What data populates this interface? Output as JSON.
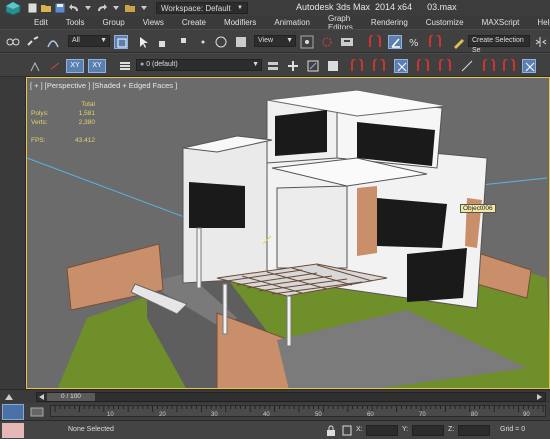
{
  "titlebar": {
    "workspace_label": "Workspace: Default",
    "title": "Autodesk 3ds Max  2014 x64      03.max"
  },
  "menu": [
    "Edit",
    "Tools",
    "Group",
    "Views",
    "Create",
    "Modifiers",
    "Animation",
    "Graph Editors",
    "Rendering",
    "Customize",
    "MAXScript",
    "Help"
  ],
  "toolbar": {
    "selection_filter": "All",
    "reference_coord": "View",
    "selection_set": "Create Selection Se",
    "layer": "0 (default)",
    "axis_xy": "XY",
    "axis_xy2": "XY"
  },
  "viewport": {
    "label": "[ + ] [Perspective ] [Shaded + Edged Faces ]",
    "stats_header": "Total",
    "polys_label": "Polys:",
    "polys_value": "1,581",
    "verts_label": "Verts:",
    "verts_value": "2,380",
    "fps_label": "FPS:",
    "fps_value": "43.412",
    "object_label": "Object006"
  },
  "timeline": {
    "frame_readout": "0 / 100",
    "ticks": [
      "10",
      "20",
      "30",
      "40",
      "50",
      "60",
      "70",
      "80",
      "90"
    ]
  },
  "status": {
    "text": "None Selected",
    "x_label": "X:",
    "y_label": "Y:",
    "z_label": "Z:",
    "x_value": "",
    "y_value": "",
    "z_value": "",
    "grid": "Grid = 0"
  },
  "colors": {
    "accent": "#e6c64a",
    "active_tool": "#5a7fb0",
    "wall": "#f2f2f2",
    "brick": "#c98f6a",
    "grass": "#6f8f2a"
  }
}
